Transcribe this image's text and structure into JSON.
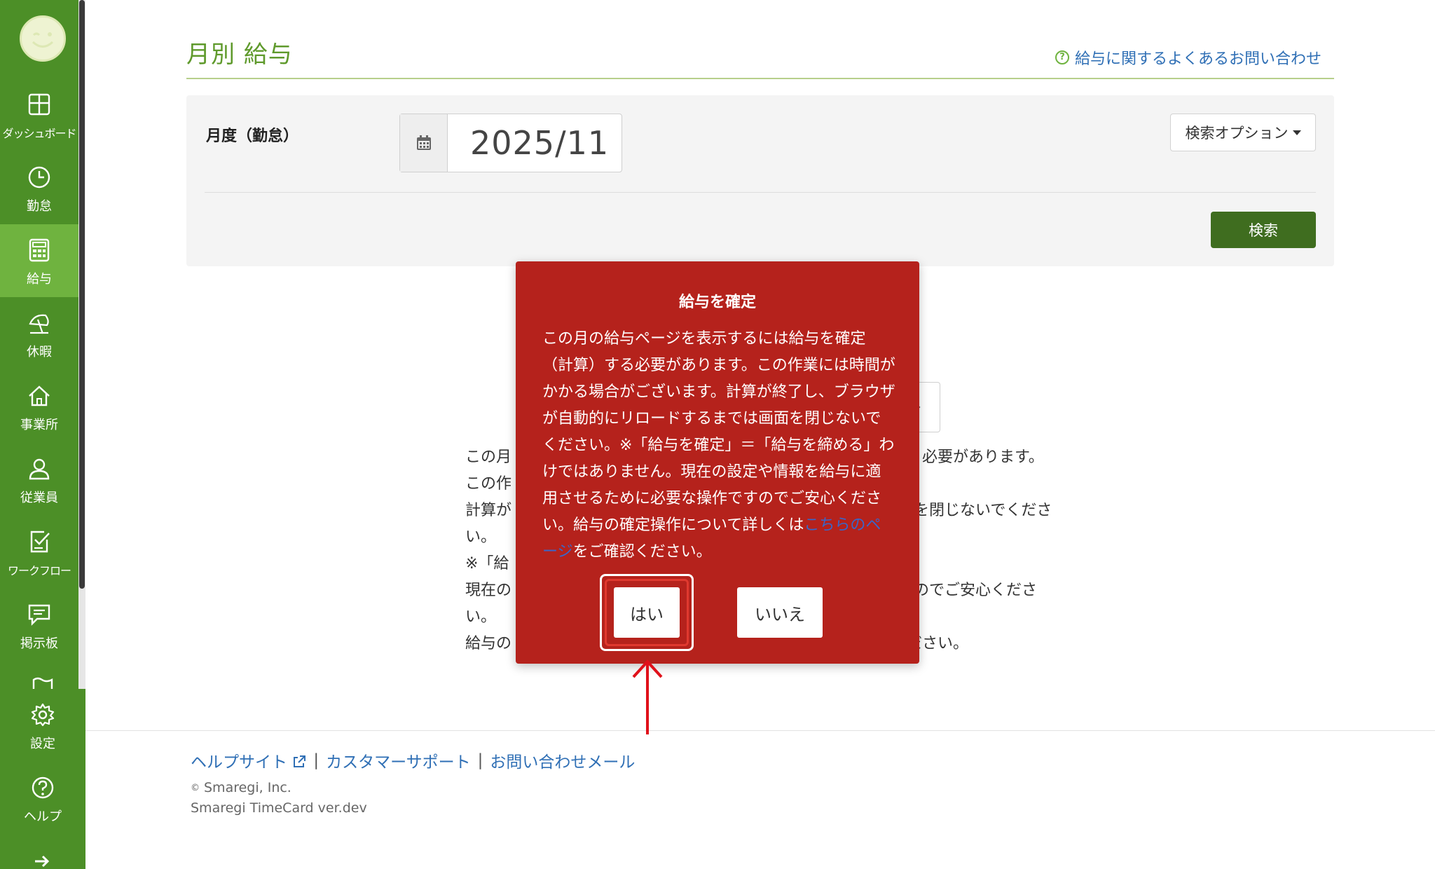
{
  "sidebar": {
    "items": [
      {
        "label": "ダッシュボード",
        "icon": "dashboard-icon"
      },
      {
        "label": "勤怠",
        "icon": "clock-icon"
      },
      {
        "label": "給与",
        "icon": "calculator-icon"
      },
      {
        "label": "休暇",
        "icon": "beach-umbrella-icon"
      },
      {
        "label": "事業所",
        "icon": "home-icon"
      },
      {
        "label": "従業員",
        "icon": "person-icon"
      },
      {
        "label": "ワークフロー",
        "icon": "checklist-icon"
      },
      {
        "label": "掲示板",
        "icon": "chat-bubble-icon"
      }
    ],
    "bottom_items": [
      {
        "label": "設定",
        "icon": "gear-icon"
      },
      {
        "label": "ヘルプ",
        "icon": "question-icon"
      }
    ],
    "active_index": 2,
    "colors": {
      "base": "#4c8f27",
      "active": "#6fb33f"
    }
  },
  "header": {
    "title": "月別 給与",
    "faq_link": "給与に関するよくあるお問い合わせ"
  },
  "search": {
    "month_label": "月度（勤怠）",
    "month_value": "2025/11",
    "options_button": "検索オプション",
    "search_button": "検索"
  },
  "body_text": {
    "lines": [
      "この月",
      "この作",
      "計算が",
      "い。",
      "※「給",
      "現在の",
      "い。",
      "給与の"
    ],
    "right_fragments": [
      "必要があります。",
      "",
      "を閉じないでくださ",
      "",
      "",
      "のでご安心くださ",
      "",
      "ださい。"
    ]
  },
  "dialog": {
    "title": "給与を確定",
    "body_before_link": "この月の給与ページを表示するには給与を確定（計算）する必要があります。この作業には時間がかかる場合がございます。計算が終了し、ブラウザが自動的にリロードするまでは画面を閉じないでください。※「給与を確定」＝「給与を締める」わけではありません。現在の設定や情報を給与に適用させるために必要な操作ですのでご安心ください。給与の確定操作について詳しくは",
    "link_text": "こちらのページ",
    "body_after_link": "をご確認ください。",
    "yes_button": "はい",
    "no_button": "いいえ",
    "background_color": "#b5221c"
  },
  "footer": {
    "help_site": "ヘルプサイト",
    "customer_support": "カスタマーサポート",
    "contact_mail": "お問い合わせメール",
    "separator": "|",
    "copyright": "Smaregi, Inc.",
    "copyright_mark": "©",
    "version": "Smaregi TimeCard ver.dev"
  }
}
